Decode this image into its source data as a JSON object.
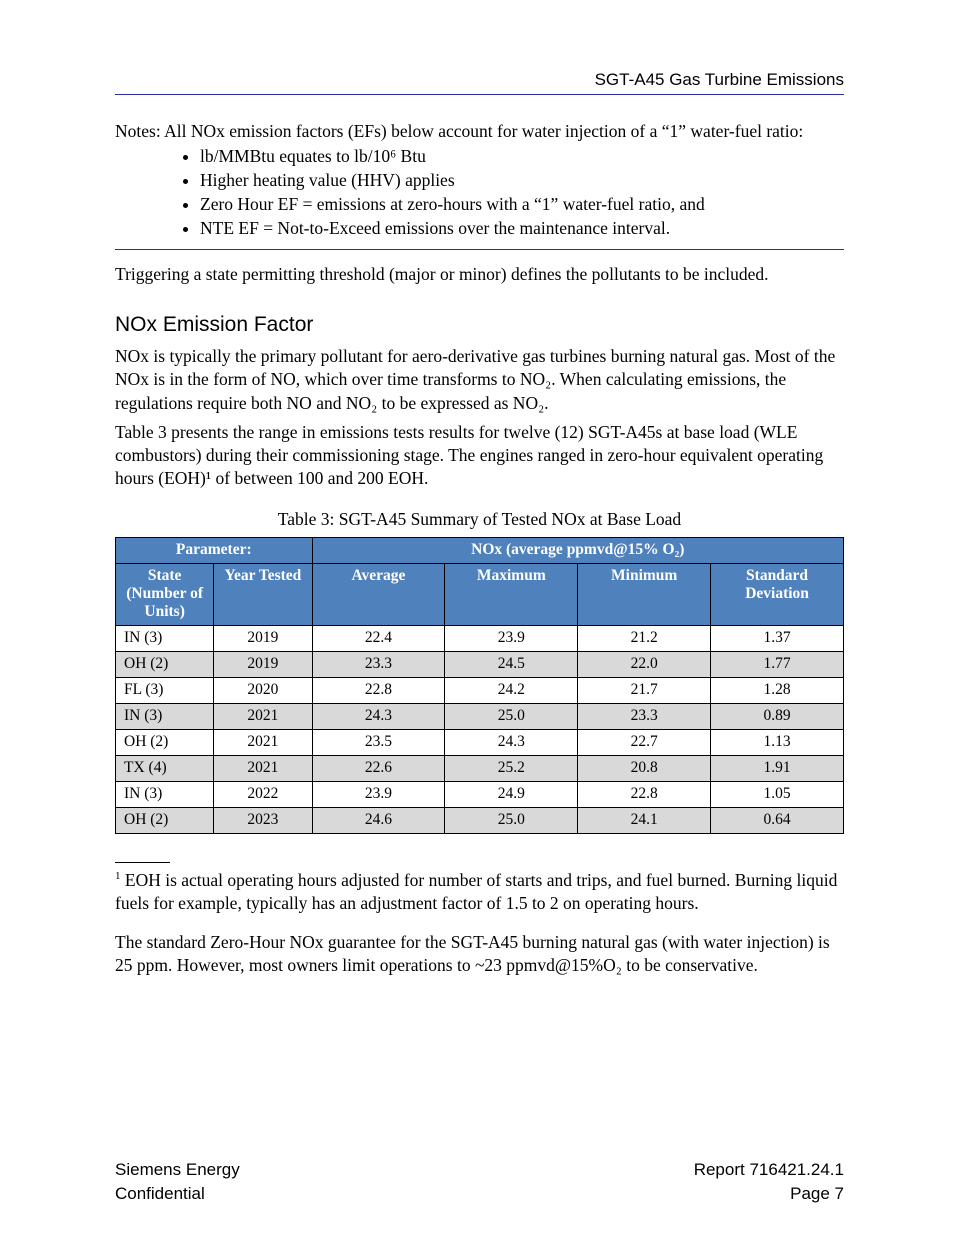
{
  "header": {
    "title": "SGT-A45 Gas Turbine Emissions"
  },
  "notes": {
    "intro_prefix": "Notes:  ",
    "intro_text": "All NOx emission factors (EFs) below account for water injection of a “1” water-fuel ratio:",
    "items": [
      "lb/MMBtu equates to lb/10⁶ Btu",
      "Higher heating value (HHV) applies",
      "Zero Hour EF = emissions at zero-hours with a “1” water-fuel ratio, and",
      "NTE EF = Not-to-Exceed emissions over the maintenance interval."
    ]
  },
  "trigger": "Triggering a state permitting threshold (major or minor) defines the pollutants to be included.",
  "h2": "NOx Emission Factor",
  "paras": {
    "p1": "NOx is typically the primary pollutant for aero-derivative gas turbines burning natural gas.  Most of the NOx is in the form of NO, which over time transforms to NO₂.  When calculating emissions, the regulations require both NO and NO₂ to be expressed as NO₂.",
    "p2_a": "Table 3",
    "p2_b": " presents the range in emissions tests results for twelve (12) SGT-A45s at base load (WLE combustors) during their commissioning stage.  The engines ranged in zero-hour equivalent operating hours (EOH)¹ of between 100 and 200 EOH."
  },
  "table": {
    "caption": "Table 3:  SGT-A45 Summary of Tested NOx at Base Load",
    "header1": {
      "param": "Parameter:",
      "nox": "NOx (average ppmvd@15% O₂)"
    },
    "header2": {
      "state": "State (Number of Units)",
      "year": "Year Tested",
      "avg": "Average",
      "max": "Maximum",
      "min": "Minimum",
      "sd": "Standard Deviation"
    },
    "rows": [
      {
        "state": "IN (3)",
        "year": "2019",
        "avg": "22.4",
        "max": "23.9",
        "min": "21.2",
        "sd": "1.37"
      },
      {
        "state": "OH (2)",
        "year": "2019",
        "avg": "23.3",
        "max": "24.5",
        "min": "22.0",
        "sd": "1.77"
      },
      {
        "state": "FL (3)",
        "year": "2020",
        "avg": "22.8",
        "max": "24.2",
        "min": "21.7",
        "sd": "1.28"
      },
      {
        "state": "IN (3)",
        "year": "2021",
        "avg": "24.3",
        "max": "25.0",
        "min": "23.3",
        "sd": "0.89"
      },
      {
        "state": "OH (2)",
        "year": "2021",
        "avg": "23.5",
        "max": "24.3",
        "min": "22.7",
        "sd": "1.13"
      },
      {
        "state": "TX (4)",
        "year": "2021",
        "avg": "22.6",
        "max": "25.2",
        "min": "20.8",
        "sd": "1.91"
      },
      {
        "state": "IN (3)",
        "year": "2022",
        "avg": "23.9",
        "max": "24.9",
        "min": "22.8",
        "sd": "1.05"
      },
      {
        "state": "OH (2)",
        "year": "2023",
        "avg": "24.6",
        "max": "25.0",
        "min": "24.1",
        "sd": "0.64"
      }
    ]
  },
  "after": "The standard Zero-Hour NOx guarantee for the SGT-A45 burning natural gas (with water injection) is 25 ppm.  However, most owners limit operations to ~23 ppmvd@15%O₂ to be conservative.",
  "footnote": {
    "num": "1",
    "text": " EOH is actual operating hours adjusted for number of starts and trips, and fuel burned.  Burning liquid fuels for example, typically has an adjustment factor of 1.5 to 2 on operating hours."
  },
  "footer": {
    "left": "Siemens Energy",
    "right": "Report 716421.24.1",
    "left2": "Confidential",
    "page": "Page 7"
  }
}
